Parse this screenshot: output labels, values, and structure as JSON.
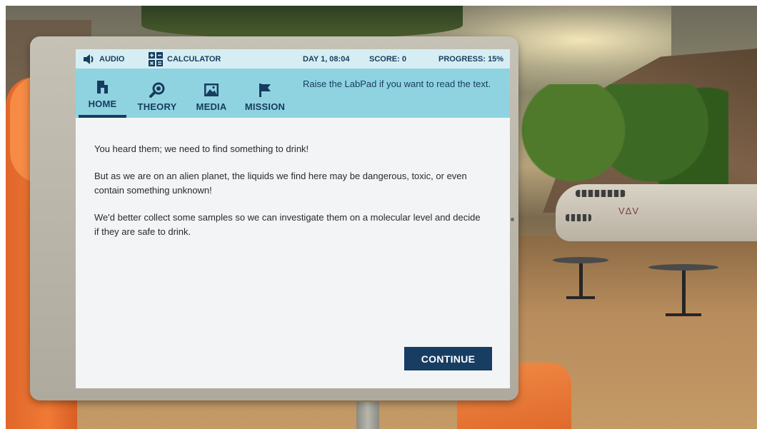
{
  "status_bar": {
    "audio_label": "AUDIO",
    "calculator_label": "CALCULATOR",
    "day_time": "DAY 1, 08:04",
    "score": "SCORE: 0",
    "progress": "PROGRESS: 15%"
  },
  "nav": {
    "tabs": [
      {
        "label": "HOME",
        "icon": "home-icon",
        "active": true
      },
      {
        "label": "THEORY",
        "icon": "magnifier-icon",
        "active": false
      },
      {
        "label": "MEDIA",
        "icon": "image-icon",
        "active": false
      },
      {
        "label": "MISSION",
        "icon": "flag-icon",
        "active": false
      }
    ],
    "hint": "Raise the LabPad if you want to read the text."
  },
  "content": {
    "paragraphs": [
      "You heard them; we need to find something to drink!",
      "But as we are on an alien planet, the liquids we find here may be dangerous, toxic, or even contain something unknown!",
      "We'd better collect some samples so we can investigate them on a molecular level and decide if they are safe to drink."
    ]
  },
  "continue_label": "CONTINUE",
  "scene": {
    "building_logo": "VΔV"
  },
  "colors": {
    "navy": "#173d63",
    "nav_bar": "#8fd3e0",
    "status_bar": "#d6eef3",
    "screen_bg": "#f3f4f5",
    "suit_orange": "#f07a35"
  }
}
